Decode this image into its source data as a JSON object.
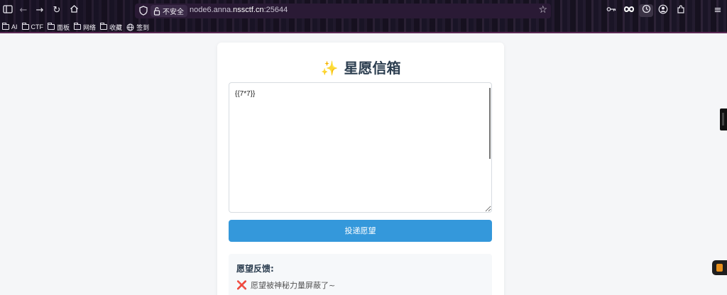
{
  "browser": {
    "url_prefix": "node6.anna.",
    "url_domain": "nssctf.cn",
    "url_suffix": ":25644",
    "security_label": "不安全",
    "bookmarks": [
      {
        "label": "AI",
        "icon": "folder-icon"
      },
      {
        "label": "CTF",
        "icon": "folder-icon"
      },
      {
        "label": "面板",
        "icon": "folder-icon"
      },
      {
        "label": "网络",
        "icon": "folder-icon"
      },
      {
        "label": "收藏",
        "icon": "folder-icon"
      },
      {
        "label": "签到",
        "icon": "globe-icon"
      }
    ]
  },
  "page": {
    "title_icon": "✨",
    "title": "星愿信箱",
    "wish_value": "{{7*7}}",
    "submit_label": "投递愿望",
    "feedback_title": "愿望反馈:",
    "feedback_icon": "❌",
    "feedback_message": "愿望被神秘力量屏蔽了~"
  },
  "colors": {
    "accent": "#3498db",
    "title": "#2c3e50",
    "error": "#e74c3c"
  }
}
